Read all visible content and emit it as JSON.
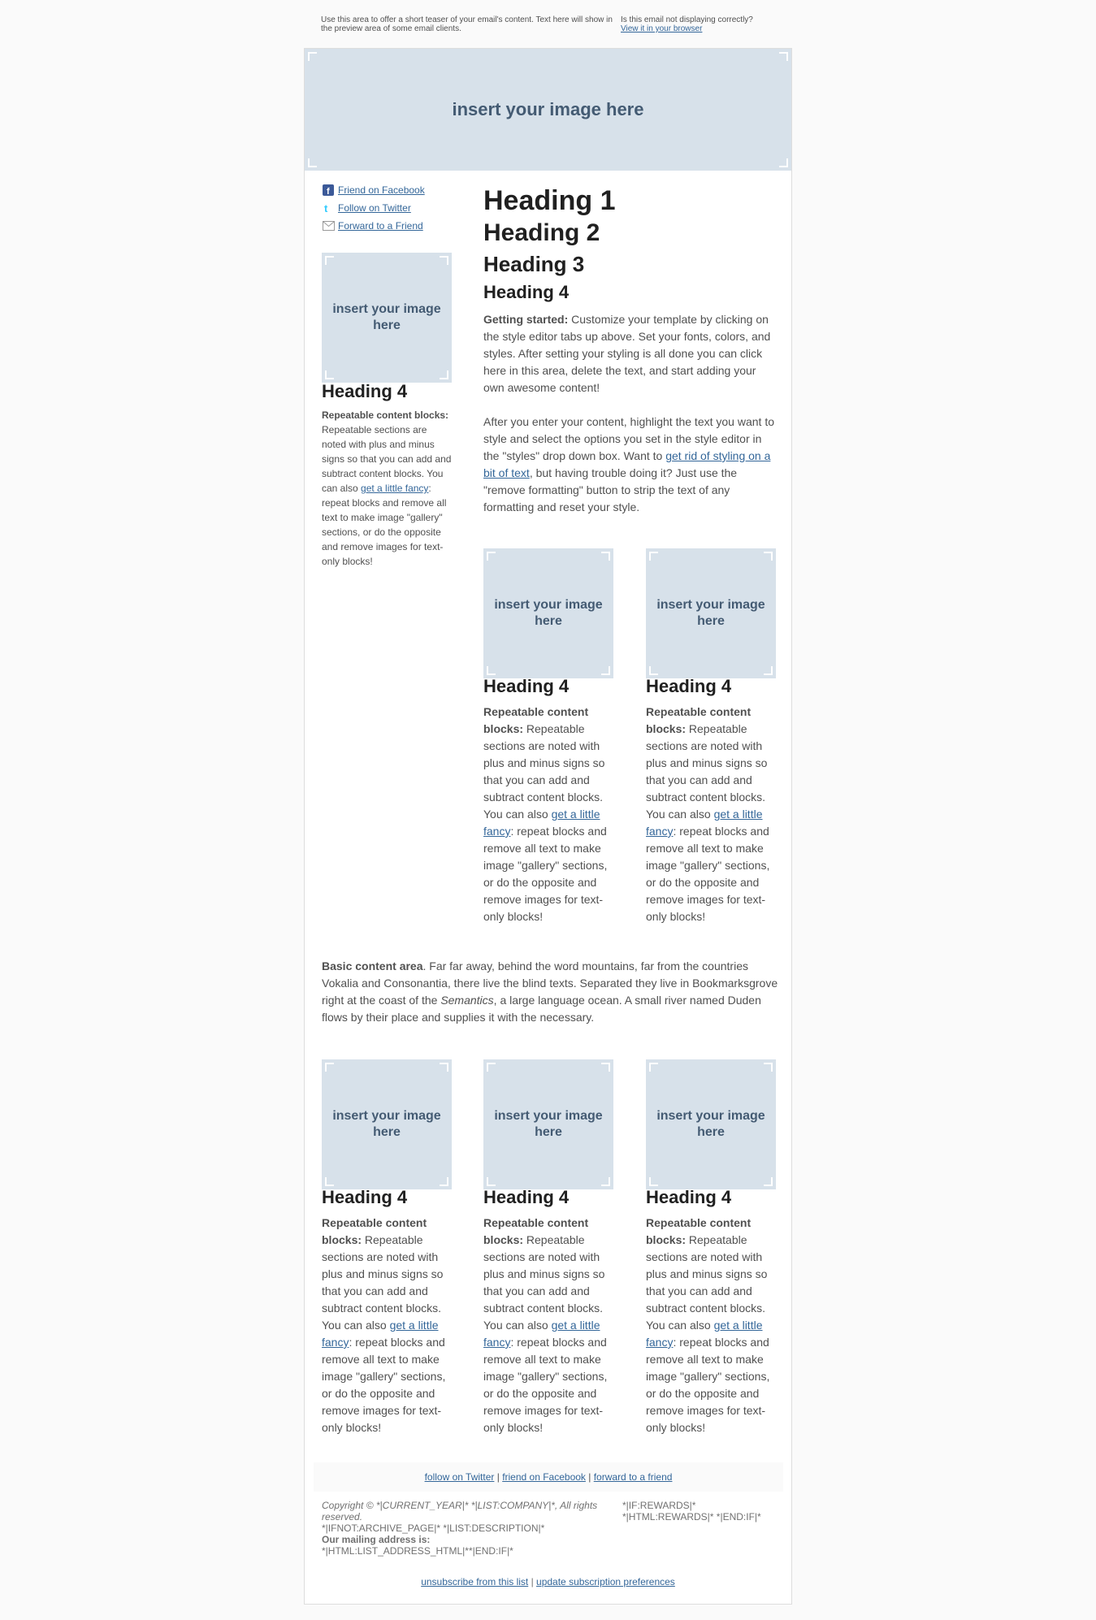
{
  "preheader": {
    "teaser": "Use this area to offer a short teaser of your email's content. Text here will show in the preview area of some email clients.",
    "not_displaying": "Is this email not displaying correctly?",
    "view_browser": "View it in your browser"
  },
  "placeholder_text": "insert your image here",
  "header_image_text": "insert your image here",
  "social": {
    "facebook": "Friend on Facebook",
    "twitter": "Follow on Twitter",
    "forward": "Forward to a Friend"
  },
  "headings": {
    "h1": "Heading 1",
    "h2": "Heading 2",
    "h3": "Heading 3",
    "h4": "Heading 4"
  },
  "main": {
    "p1_bold": "Getting started:",
    "p1_text": " Customize your template by clicking on the style editor tabs up above. Set your fonts, colors, and styles. After setting your styling is all done you can click here in this area, delete the text, and start adding your own awesome content!",
    "p2_a": "After you enter your content, highlight the text you want to style and select the options you set in the style editor in the \"styles\" drop down box. Want to ",
    "p2_link": "get rid of styling on a bit of text",
    "p2_b": ", but having trouble doing it? Just use the \"remove formatting\" button to strip the text of any formatting and reset your style."
  },
  "block": {
    "bold": "Repeatable content blocks:",
    "a": " Repeatable sections are noted with plus and minus signs so that you can add and subtract content blocks. You can also ",
    "link": "get a little fancy",
    "b": ": repeat blocks and remove all text to make image \"gallery\" sections, or do the opposite and remove images for text-only blocks!"
  },
  "basic": {
    "bold": "Basic content area",
    "a": ". Far far away, behind the word mountains, far from the countries Vokalia and Consonantia, there live the blind texts. Separated they live in Bookmarksgrove right at the coast of the ",
    "italic": "Semantics",
    "b": ", a large language ocean. A small river named Duden flows by their place and supplies it with the necessary."
  },
  "footer": {
    "follow_twitter": "follow on Twitter",
    "friend_facebook": "friend on Facebook",
    "forward_friend": "forward to a friend",
    "sep": " | ",
    "copyright": "Copyright © *|CURRENT_YEAR|* *|LIST:COMPANY|*, All rights reserved.",
    "archive": "*|IFNOT:ARCHIVE_PAGE|* *|LIST:DESCRIPTION|*",
    "mailing_label": "Our mailing address is:",
    "address": "*|HTML:LIST_ADDRESS_HTML|**|END:IF|*",
    "rewards1": "*|IF:REWARDS|*",
    "rewards2": "*|HTML:REWARDS|* *|END:IF|*",
    "unsubscribe": "unsubscribe from this list",
    "update_prefs": "update subscription preferences"
  },
  "colors": {
    "placeholder_bg": "#d7e1ea",
    "placeholder_text": "#445b73",
    "link": "#336699",
    "heading": "#202020",
    "body_text": "#505050"
  }
}
